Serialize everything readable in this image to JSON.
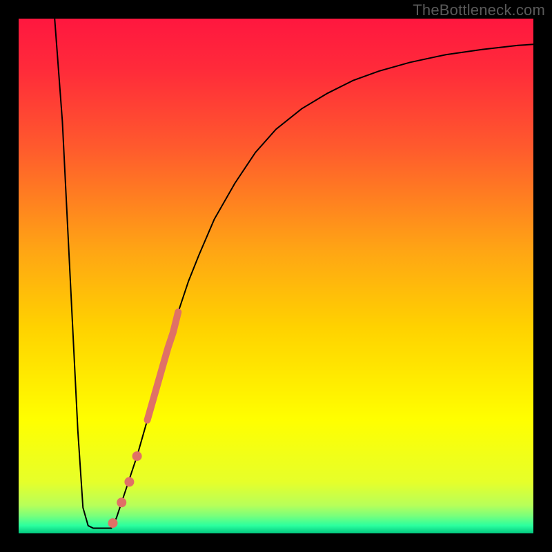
{
  "watermark": "TheBottleneck.com",
  "chart_data": {
    "type": "line",
    "title": "",
    "xlabel": "",
    "ylabel": "",
    "xlim": [
      0,
      100
    ],
    "ylim": [
      0,
      100
    ],
    "grid": false,
    "gradient": {
      "direction": "vertical",
      "stops": [
        {
          "offset": 0.0,
          "color": "#ff173f"
        },
        {
          "offset": 0.1,
          "color": "#ff2b3a"
        },
        {
          "offset": 0.25,
          "color": "#ff5a2d"
        },
        {
          "offset": 0.45,
          "color": "#ffa514"
        },
        {
          "offset": 0.6,
          "color": "#ffd200"
        },
        {
          "offset": 0.78,
          "color": "#ffff00"
        },
        {
          "offset": 0.9,
          "color": "#e6ff2a"
        },
        {
          "offset": 0.945,
          "color": "#b8ff59"
        },
        {
          "offset": 0.965,
          "color": "#7dff7a"
        },
        {
          "offset": 0.985,
          "color": "#2bff9f"
        },
        {
          "offset": 1.0,
          "color": "#02c87f"
        }
      ]
    },
    "series": [
      {
        "name": "bottleneck-curve",
        "color": "#000000",
        "stroke_width": 2,
        "x": [
          7.0,
          8.5,
          9.5,
          10.5,
          11.5,
          12.5,
          13.5,
          14.5,
          18.0,
          19.0,
          20.0,
          21.0,
          22.0,
          23.0,
          25.0,
          27.0,
          29.0,
          30.0,
          31.0,
          33.0,
          35.0,
          38.0,
          42.0,
          46.0,
          50.0,
          55.0,
          60.0,
          65.0,
          70.0,
          76.0,
          83.0,
          90.0,
          97.0,
          100.0
        ],
        "y": [
          100.0,
          80.0,
          60.0,
          40.0,
          20.0,
          5.0,
          1.5,
          1.0,
          1.0,
          3.0,
          6.0,
          9.0,
          12.0,
          15.0,
          22.0,
          29.0,
          36.0,
          39.0,
          43.0,
          49.0,
          54.0,
          61.0,
          68.0,
          74.0,
          78.5,
          82.5,
          85.5,
          88.0,
          89.8,
          91.5,
          93.0,
          94.0,
          94.8,
          95.0
        ]
      }
    ],
    "highlight_band": {
      "color": "#e07166",
      "stroke_width": 10,
      "x": [
        25.0,
        26.0,
        27.0,
        28.0,
        29.0,
        30.0,
        31.0
      ],
      "y": [
        22.0,
        25.5,
        29.0,
        32.5,
        36.0,
        39.0,
        43.0
      ]
    },
    "highlight_points": {
      "color": "#e07166",
      "radius": 7,
      "points": [
        {
          "x": 23.0,
          "y": 15.0
        },
        {
          "x": 21.5,
          "y": 10.0
        },
        {
          "x": 20.0,
          "y": 6.0
        },
        {
          "x": 18.3,
          "y": 2.0
        }
      ]
    }
  }
}
